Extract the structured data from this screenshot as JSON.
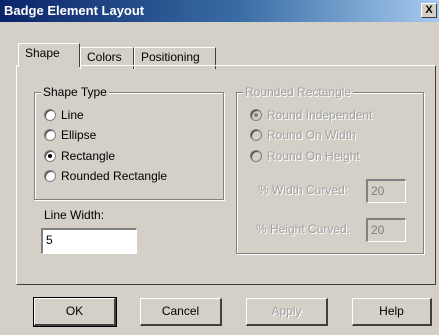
{
  "window": {
    "title": "Badge Element Layout",
    "close_glyph": "X"
  },
  "tabs": [
    {
      "label": "Shape",
      "active": true
    },
    {
      "label": "Colors",
      "active": false
    },
    {
      "label": "Positioning",
      "active": false
    }
  ],
  "shape_type": {
    "title": "Shape Type",
    "options": [
      "Line",
      "Ellipse",
      "Rectangle",
      "Rounded Rectangle"
    ],
    "selected": "Rectangle"
  },
  "line_width": {
    "label": "Line Width:",
    "value": "5"
  },
  "rounded_rectangle": {
    "title": "Rounded Rectangle",
    "enabled": false,
    "options": [
      "Round Independent",
      "Round On Width",
      "Round On Height"
    ],
    "selected": "Round Independent",
    "width_curved_label": "% Width Curved:",
    "width_curved_value": "20",
    "height_curved_label": "% Height Curved:",
    "height_curved_value": "20"
  },
  "buttons": {
    "ok": "OK",
    "cancel": "Cancel",
    "apply": "Apply",
    "help": "Help"
  }
}
